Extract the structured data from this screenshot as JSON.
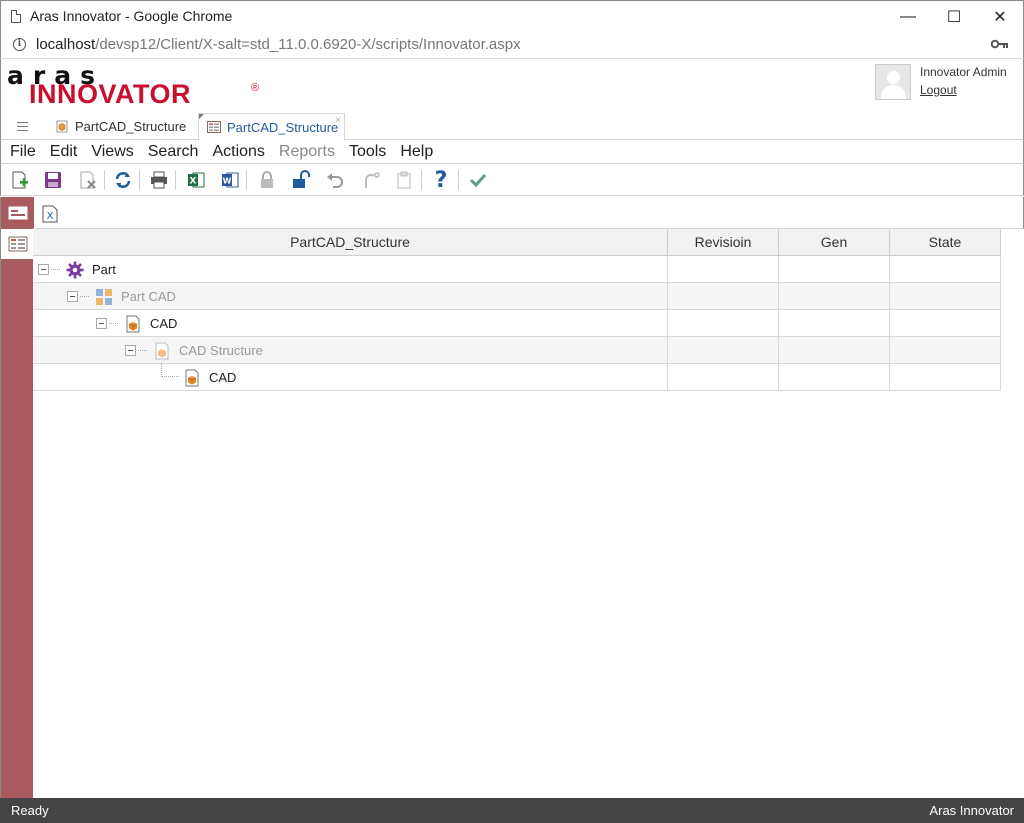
{
  "window": {
    "title": "Aras Innovator - Google Chrome",
    "minimize": "—",
    "maximize": "☐",
    "close": "✕"
  },
  "address": {
    "host": "localhost",
    "path": "/devsp12/Client/X-salt=std_11.0.0.6920-X/scripts/Innovator.aspx"
  },
  "logo": {
    "top": "aras",
    "bottom": "INNOVATOR",
    "reg": "®"
  },
  "user": {
    "name": "Innovator Admin",
    "logout": "Logout"
  },
  "tabs": [
    {
      "label": "PartCAD_Structure",
      "icon": "cad-structure-icon",
      "active": false
    },
    {
      "label": "PartCAD_Structure",
      "icon": "tree-grid-icon",
      "active": true,
      "close": "×"
    }
  ],
  "menu": [
    {
      "label": "File",
      "enabled": true
    },
    {
      "label": "Edit",
      "enabled": true
    },
    {
      "label": "Views",
      "enabled": true
    },
    {
      "label": "Search",
      "enabled": true
    },
    {
      "label": "Actions",
      "enabled": true
    },
    {
      "label": "Reports",
      "enabled": false
    },
    {
      "label": "Tools",
      "enabled": true
    },
    {
      "label": "Help",
      "enabled": true
    }
  ],
  "toolbar": {
    "icons": [
      "new-icon",
      "save-icon",
      "discard-icon",
      "refresh-icon",
      "print-icon",
      "excel-icon",
      "word-icon",
      "lock-icon",
      "unlock-icon",
      "undo-icon",
      "redo-icon",
      "paste-icon",
      "help-icon",
      "done-icon"
    ],
    "help_glyph": "?",
    "excel_letter": "X",
    "word_letter": "W"
  },
  "subbar": {
    "export_letter": "X"
  },
  "grid": {
    "columns": [
      "PartCAD_Structure",
      "Revisioin",
      "Gen",
      "State"
    ],
    "rows": [
      {
        "label": "Part",
        "level": 0,
        "icon": "part-gear-icon",
        "dim": false,
        "toggle": true,
        "revision": "",
        "gen": "",
        "state": ""
      },
      {
        "label": "Part CAD",
        "level": 1,
        "icon": "relationship-icon",
        "dim": true,
        "toggle": true,
        "revision": "",
        "gen": "",
        "state": ""
      },
      {
        "label": "CAD",
        "level": 2,
        "icon": "cad-document-icon",
        "dim": false,
        "toggle": true,
        "revision": "",
        "gen": "",
        "state": ""
      },
      {
        "label": "CAD Structure",
        "level": 3,
        "icon": "cad-structure-icon",
        "dim": true,
        "toggle": true,
        "revision": "",
        "gen": "",
        "state": ""
      },
      {
        "label": "CAD",
        "level": 4,
        "icon": "cad-document-icon",
        "dim": false,
        "toggle": false,
        "revision": "",
        "gen": "",
        "state": ""
      }
    ]
  },
  "status": {
    "left": "Ready",
    "right": "Aras Innovator"
  }
}
